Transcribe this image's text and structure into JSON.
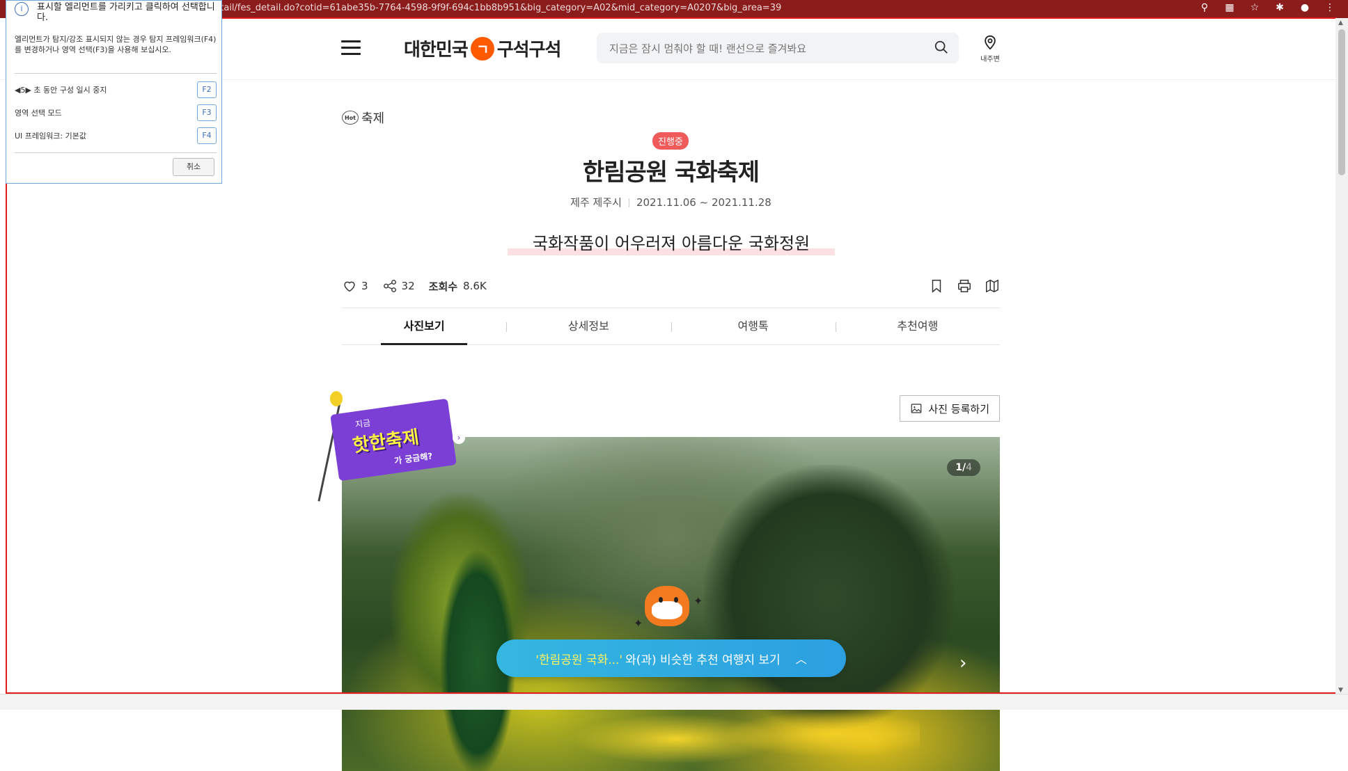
{
  "browser": {
    "url": "detail/fes_detail.do?cotid=61abe35b-7764-4598-9f9f-694c1bb8b951&big_category=A02&mid_category=A0207&big_area=39",
    "icons": [
      "location-icon",
      "grid-icon",
      "star-icon",
      "extension-icon",
      "profile-icon",
      "menu-dots-icon"
    ]
  },
  "picker": {
    "heading": "표시할 엘리먼트를 가리키고 클릭하여 선택합니다.",
    "description": "엘리먼트가 탐지/강조 표시되지 않는 경우 탐지 프레임워크(F4)를 변경하거나 영역 선택(F3)을 사용해 보십시오.",
    "options": [
      {
        "label": "◀5▶ 초 동안 구성 일시 중지",
        "key": "F2"
      },
      {
        "label": "영역 선택 모드",
        "key": "F3"
      },
      {
        "label": "UI 프레임워크: 기본값",
        "key": "F4"
      }
    ],
    "cancel": "취소"
  },
  "header": {
    "logo_left": "대한민국",
    "logo_mark": "ㄱ",
    "logo_right": "구석구석",
    "search_placeholder": "지금은 잠시 멈춰야 할 때! 랜선으로 즐겨봐요",
    "near_me": "내주변"
  },
  "festival": {
    "category_hot": "Hot",
    "category": "축제",
    "status": "진행중",
    "title": "한림공원 국화축제",
    "region": "제주 제주시",
    "period": "2021.11.06 ~ 2021.11.28",
    "subtitle": "국화작품이 어우러져 아름다운 국화정원",
    "likes": "3",
    "shares": "32",
    "views_label": "조회수",
    "views": "8.6K"
  },
  "tabs": [
    "사진보기",
    "상세정보",
    "여행톡",
    "추천여행"
  ],
  "active_tab": 0,
  "photo": {
    "register": "사진 등록하기",
    "current": "1",
    "total": "4"
  },
  "banner": {
    "small": "지금",
    "big": "핫한축제",
    "sub": "가 궁금해?"
  },
  "recommend": {
    "highlight": "'한림공원 국화...'",
    "text": "와(과) 비슷한 추천 여행지 보기"
  },
  "colors": {
    "browser_bar": "#8b1c1c",
    "selection_border": "#e31d1d",
    "status_badge": "#ef5a5a",
    "logo_accent": "#ff5a00",
    "recommend_bar": "#34b7e0"
  }
}
